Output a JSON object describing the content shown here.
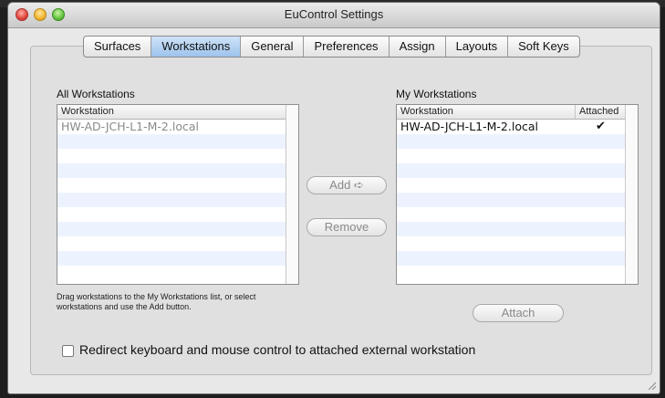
{
  "window": {
    "title": "EuControl Settings"
  },
  "tabs": [
    {
      "label": "Surfaces"
    },
    {
      "label": "Workstations"
    },
    {
      "label": "General"
    },
    {
      "label": "Preferences"
    },
    {
      "label": "Assign"
    },
    {
      "label": "Layouts"
    },
    {
      "label": "Soft Keys"
    }
  ],
  "active_tab": "Workstations",
  "all_workstations": {
    "title": "All Workstations",
    "column": "Workstation",
    "rows": [
      "HW-AD-JCH-L1-M-2.local"
    ]
  },
  "my_workstations": {
    "title": "My Workstations",
    "columns": [
      "Workstation",
      "Attached"
    ],
    "rows": [
      {
        "name": "HW-AD-JCH-L1-M-2.local",
        "attached": "✔"
      }
    ]
  },
  "buttons": {
    "add": "Add ➪",
    "remove": "Remove",
    "attach": "Attach"
  },
  "hint": "Drag workstations to the My Workstations list, or select workstations and use the Add button.",
  "redirect_checkbox": {
    "label": "Redirect keyboard and mouse control to attached external workstation",
    "checked": false
  },
  "colors": {
    "tab_active": "#9dc3ec",
    "row_alt": "#edf3fe"
  }
}
